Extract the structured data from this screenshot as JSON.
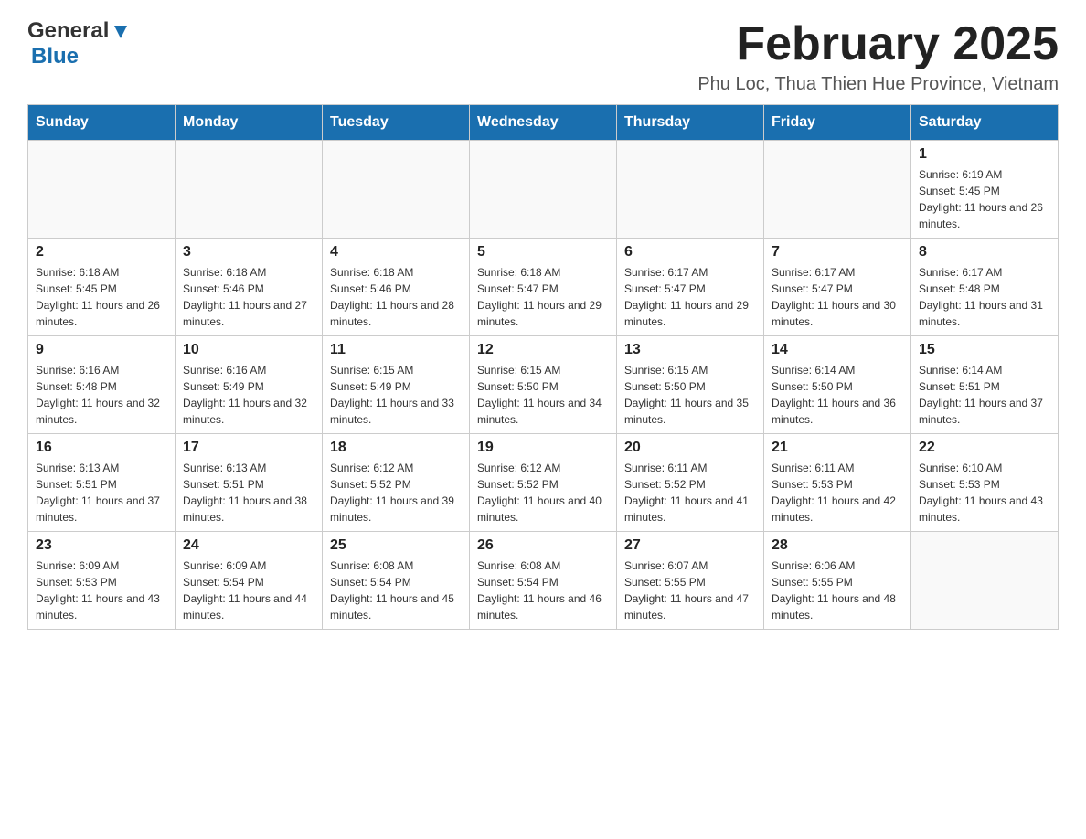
{
  "header": {
    "logo": {
      "general": "General",
      "blue": "Blue"
    },
    "title": "February 2025",
    "location": "Phu Loc, Thua Thien Hue Province, Vietnam"
  },
  "days_of_week": [
    "Sunday",
    "Monday",
    "Tuesday",
    "Wednesday",
    "Thursday",
    "Friday",
    "Saturday"
  ],
  "weeks": [
    [
      {
        "day": "",
        "info": ""
      },
      {
        "day": "",
        "info": ""
      },
      {
        "day": "",
        "info": ""
      },
      {
        "day": "",
        "info": ""
      },
      {
        "day": "",
        "info": ""
      },
      {
        "day": "",
        "info": ""
      },
      {
        "day": "1",
        "info": "Sunrise: 6:19 AM\nSunset: 5:45 PM\nDaylight: 11 hours and 26 minutes."
      }
    ],
    [
      {
        "day": "2",
        "info": "Sunrise: 6:18 AM\nSunset: 5:45 PM\nDaylight: 11 hours and 26 minutes."
      },
      {
        "day": "3",
        "info": "Sunrise: 6:18 AM\nSunset: 5:46 PM\nDaylight: 11 hours and 27 minutes."
      },
      {
        "day": "4",
        "info": "Sunrise: 6:18 AM\nSunset: 5:46 PM\nDaylight: 11 hours and 28 minutes."
      },
      {
        "day": "5",
        "info": "Sunrise: 6:18 AM\nSunset: 5:47 PM\nDaylight: 11 hours and 29 minutes."
      },
      {
        "day": "6",
        "info": "Sunrise: 6:17 AM\nSunset: 5:47 PM\nDaylight: 11 hours and 29 minutes."
      },
      {
        "day": "7",
        "info": "Sunrise: 6:17 AM\nSunset: 5:47 PM\nDaylight: 11 hours and 30 minutes."
      },
      {
        "day": "8",
        "info": "Sunrise: 6:17 AM\nSunset: 5:48 PM\nDaylight: 11 hours and 31 minutes."
      }
    ],
    [
      {
        "day": "9",
        "info": "Sunrise: 6:16 AM\nSunset: 5:48 PM\nDaylight: 11 hours and 32 minutes."
      },
      {
        "day": "10",
        "info": "Sunrise: 6:16 AM\nSunset: 5:49 PM\nDaylight: 11 hours and 32 minutes."
      },
      {
        "day": "11",
        "info": "Sunrise: 6:15 AM\nSunset: 5:49 PM\nDaylight: 11 hours and 33 minutes."
      },
      {
        "day": "12",
        "info": "Sunrise: 6:15 AM\nSunset: 5:50 PM\nDaylight: 11 hours and 34 minutes."
      },
      {
        "day": "13",
        "info": "Sunrise: 6:15 AM\nSunset: 5:50 PM\nDaylight: 11 hours and 35 minutes."
      },
      {
        "day": "14",
        "info": "Sunrise: 6:14 AM\nSunset: 5:50 PM\nDaylight: 11 hours and 36 minutes."
      },
      {
        "day": "15",
        "info": "Sunrise: 6:14 AM\nSunset: 5:51 PM\nDaylight: 11 hours and 37 minutes."
      }
    ],
    [
      {
        "day": "16",
        "info": "Sunrise: 6:13 AM\nSunset: 5:51 PM\nDaylight: 11 hours and 37 minutes."
      },
      {
        "day": "17",
        "info": "Sunrise: 6:13 AM\nSunset: 5:51 PM\nDaylight: 11 hours and 38 minutes."
      },
      {
        "day": "18",
        "info": "Sunrise: 6:12 AM\nSunset: 5:52 PM\nDaylight: 11 hours and 39 minutes."
      },
      {
        "day": "19",
        "info": "Sunrise: 6:12 AM\nSunset: 5:52 PM\nDaylight: 11 hours and 40 minutes."
      },
      {
        "day": "20",
        "info": "Sunrise: 6:11 AM\nSunset: 5:52 PM\nDaylight: 11 hours and 41 minutes."
      },
      {
        "day": "21",
        "info": "Sunrise: 6:11 AM\nSunset: 5:53 PM\nDaylight: 11 hours and 42 minutes."
      },
      {
        "day": "22",
        "info": "Sunrise: 6:10 AM\nSunset: 5:53 PM\nDaylight: 11 hours and 43 minutes."
      }
    ],
    [
      {
        "day": "23",
        "info": "Sunrise: 6:09 AM\nSunset: 5:53 PM\nDaylight: 11 hours and 43 minutes."
      },
      {
        "day": "24",
        "info": "Sunrise: 6:09 AM\nSunset: 5:54 PM\nDaylight: 11 hours and 44 minutes."
      },
      {
        "day": "25",
        "info": "Sunrise: 6:08 AM\nSunset: 5:54 PM\nDaylight: 11 hours and 45 minutes."
      },
      {
        "day": "26",
        "info": "Sunrise: 6:08 AM\nSunset: 5:54 PM\nDaylight: 11 hours and 46 minutes."
      },
      {
        "day": "27",
        "info": "Sunrise: 6:07 AM\nSunset: 5:55 PM\nDaylight: 11 hours and 47 minutes."
      },
      {
        "day": "28",
        "info": "Sunrise: 6:06 AM\nSunset: 5:55 PM\nDaylight: 11 hours and 48 minutes."
      },
      {
        "day": "",
        "info": ""
      }
    ]
  ]
}
